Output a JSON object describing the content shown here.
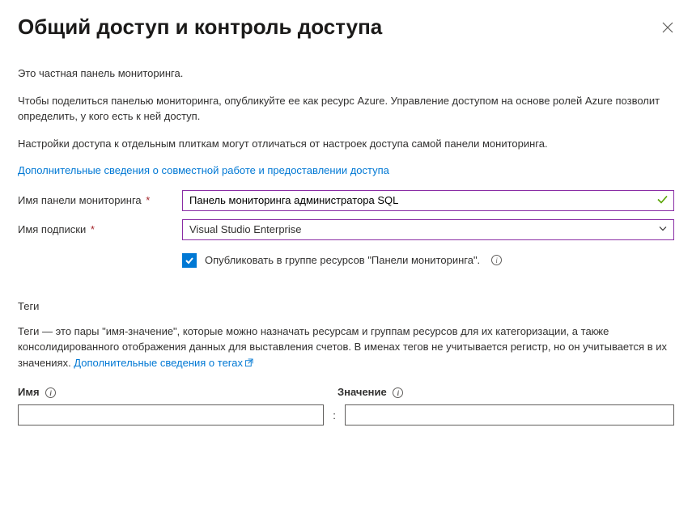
{
  "header": {
    "title": "Общий доступ и контроль доступа"
  },
  "intro": {
    "line1": "Это частная панель мониторинга.",
    "line2": "Чтобы поделиться панелью мониторинга, опубликуйте ее как ресурс Azure. Управление доступом на основе ролей Azure позволит определить, у кого есть к ней доступ.",
    "line3": "Настройки доступа к отдельным плиткам могут отличаться от настроек доступа самой панели мониторинга.",
    "learnLink": "Дополнительные сведения о совместной работе и предоставлении доступа"
  },
  "form": {
    "dashboardNameLabel": "Имя панели мониторинга",
    "dashboardNameValue": "Панель мониторинга администратора SQL",
    "subscriptionLabel": "Имя подписки",
    "subscriptionValue": "Visual Studio Enterprise",
    "publishCheckboxLabel": "Опубликовать в группе ресурсов \"Панели мониторинга\".",
    "publishChecked": true
  },
  "tags": {
    "sectionTitle": "Теги",
    "description": "Теги — это пары \"имя-значение\", которые можно назначать ресурсам и группам ресурсов для их категоризации, а также консолидированного отображения данных для выставления счетов. В именах тегов не учитывается регистр, но он учитывается в их значениях. ",
    "learnLink": "Дополнительные сведения о тегах",
    "nameHeader": "Имя",
    "valueHeader": "Значение",
    "row": {
      "name": "",
      "value": ""
    }
  }
}
